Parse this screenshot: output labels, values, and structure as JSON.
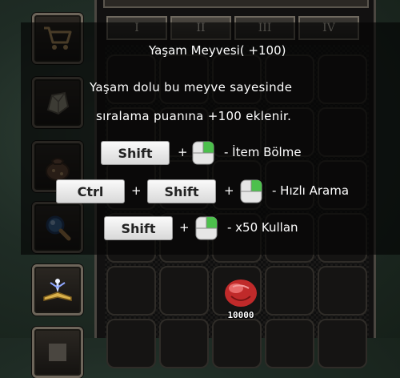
{
  "sidebar": {
    "buttons": [
      {
        "icon": "cart-icon"
      },
      {
        "icon": "stone-icon"
      },
      {
        "icon": "pouch-icon"
      },
      {
        "icon": "magnifier-icon"
      },
      {
        "icon": "book-icon"
      },
      {
        "icon": "extra-icon"
      }
    ]
  },
  "inventory": {
    "tabs": [
      "I",
      "II",
      "III",
      "IV"
    ],
    "active_tab": "II",
    "item": {
      "icon": "fruit-icon",
      "count": "10000"
    }
  },
  "tooltip": {
    "title": "Yaşam Meyvesi( +100)",
    "description": [
      "Yaşam dolu bu meyve sayesinde",
      "sıralama puanına +100 eklenir."
    ],
    "shortcuts": [
      {
        "keys": [
          "Shift"
        ],
        "plus": "+",
        "action": "- İtem Bölme"
      },
      {
        "keys": [
          "Ctrl",
          "Shift"
        ],
        "plus": "+",
        "action": "- Hızlı Arama"
      },
      {
        "keys": [
          "Shift"
        ],
        "plus": "+",
        "action": "- x50 Kullan"
      }
    ]
  }
}
